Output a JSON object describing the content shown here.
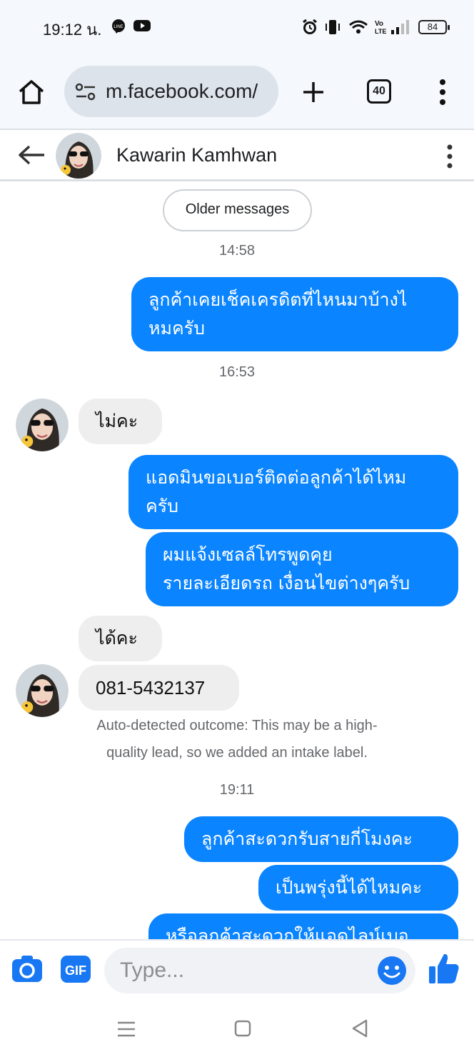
{
  "status_bar": {
    "time": "19:12 น.",
    "battery": "84"
  },
  "browser": {
    "url": "m.facebook.com/",
    "tab_count": "40"
  },
  "chat": {
    "contact_name": "Kawarin Kamhwan",
    "older_label": "Older messages",
    "timestamps": [
      "14:58",
      "16:53",
      "19:11"
    ],
    "messages": [
      {
        "from": "me",
        "lines": [
          "ลูกค้าเคยเช็คเครดิตที่ไหนมาบ้างไ",
          "หมครับ"
        ]
      },
      {
        "from": "them",
        "lines": [
          "ไม่คะ"
        ]
      },
      {
        "from": "me",
        "lines": [
          "แอดมินขอเบอร์ติดต่อลูกค้าได้ไหม",
          "ครับ"
        ]
      },
      {
        "from": "me",
        "lines": [
          "ผมแจ้งเซลล์โทรพูดคุย",
          "รายละเอียดรถ เงื่อนไขต่างๆครับ"
        ]
      },
      {
        "from": "them",
        "lines": [
          "ได้คะ"
        ]
      },
      {
        "from": "them",
        "lines": [
          "081-5432137"
        ]
      },
      {
        "from": "me",
        "lines": [
          "ลูกค้าสะดวกรับสายกี่โมงคะ"
        ]
      },
      {
        "from": "me",
        "lines": [
          "เป็นพรุ่งนี้ได้ไหมคะ"
        ]
      },
      {
        "from": "me",
        "lines": [
          "หรือลูกค้าสะดวกให้แอดไลน์เบอ"
        ]
      }
    ],
    "auto_note_lines": [
      "Auto-detected outcome: This may be a high-",
      "quality lead, so we added an intake label."
    ]
  },
  "composer": {
    "placeholder": "Type..."
  },
  "colors": {
    "outgoing_bubble": "#0a84ff",
    "incoming_bubble": "#eeeeee",
    "composer_icons": "#1877f2"
  }
}
